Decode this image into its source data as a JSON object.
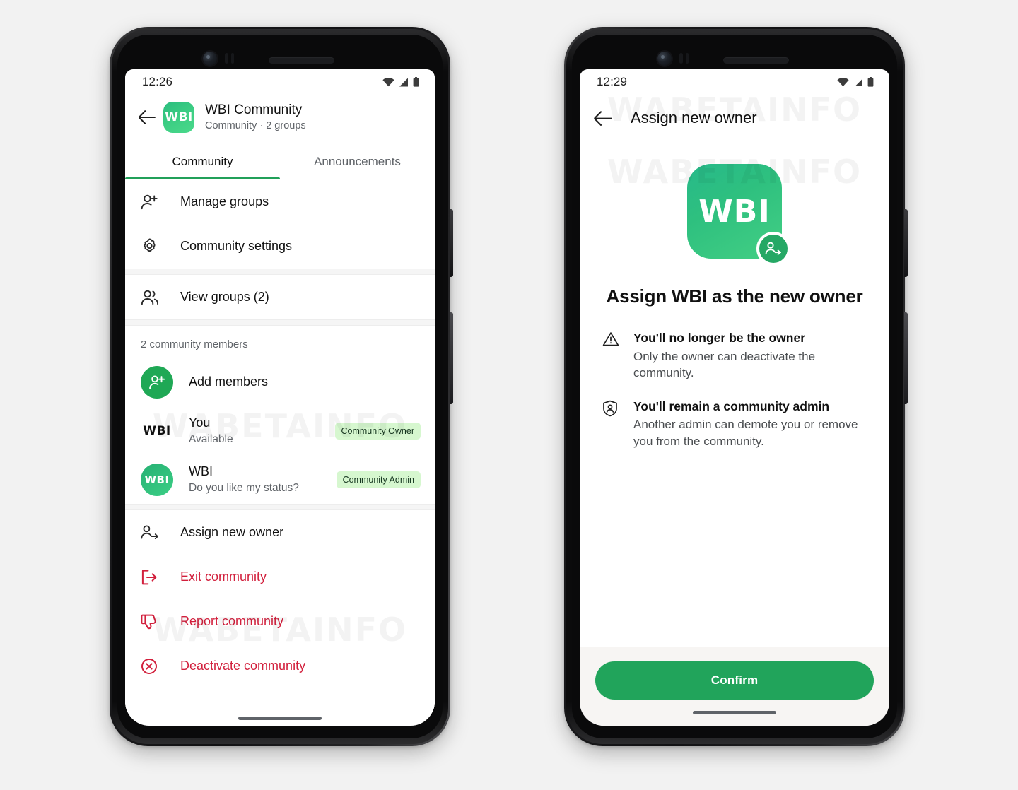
{
  "phone_left": {
    "status_bar": {
      "time": "12:26",
      "icons": [
        "wifi-icon",
        "signal-icon",
        "battery-icon"
      ]
    },
    "app_bar": {
      "back_icon": "back-arrow-icon",
      "avatar_text": "WBI",
      "title": "WBI Community",
      "subtitle": "Community · 2 groups"
    },
    "tabs": [
      {
        "label": "Community",
        "active": true
      },
      {
        "label": "Announcements",
        "active": false
      }
    ],
    "menu_section_1": [
      {
        "icon": "person-add-icon",
        "label": "Manage groups"
      },
      {
        "icon": "gear-icon",
        "label": "Community settings"
      }
    ],
    "menu_section_2": [
      {
        "icon": "people-icon",
        "label": "View groups (2)"
      }
    ],
    "members_header": "2 community members",
    "members": [
      {
        "avatar": "add-member-icon",
        "name": "Add members",
        "status": "",
        "badge": ""
      },
      {
        "avatar": "WBI",
        "name": "You",
        "status": "Available",
        "badge": "Community Owner"
      },
      {
        "avatar": "WBI",
        "name": "WBI",
        "status": "Do you like my status?",
        "badge": "Community Admin"
      }
    ],
    "actions": [
      {
        "icon": "assign-owner-icon",
        "label": "Assign new owner",
        "danger": false
      },
      {
        "icon": "exit-icon",
        "label": "Exit community",
        "danger": true
      },
      {
        "icon": "thumbs-down-icon",
        "label": "Report community",
        "danger": true
      },
      {
        "icon": "close-circle-icon",
        "label": "Deactivate community",
        "danger": true
      }
    ]
  },
  "phone_right": {
    "status_bar": {
      "time": "12:29",
      "icons": [
        "wifi-icon",
        "signal-icon",
        "battery-icon"
      ]
    },
    "app_bar": {
      "back_icon": "back-arrow-icon",
      "title": "Assign new owner"
    },
    "hero": {
      "icon_text": "WBI",
      "badge_icon": "assign-owner-icon",
      "title": "Assign WBI as the new owner"
    },
    "info_items": [
      {
        "icon": "warning-triangle-icon",
        "title": "You'll no longer be the owner",
        "desc": "Only the owner can deactivate the community."
      },
      {
        "icon": "shield-person-icon",
        "title": "You'll remain a community admin",
        "desc": "Another admin can demote you or remove you from the community."
      }
    ],
    "confirm_label": "Confirm"
  },
  "watermark": "WABETAINFO",
  "colors": {
    "brand_green": "#21a45b",
    "accent_green": "#21a059",
    "badge_bg": "#d6f7cf",
    "danger_red": "#d21f3c",
    "page_bg": "#f2f2f2"
  }
}
